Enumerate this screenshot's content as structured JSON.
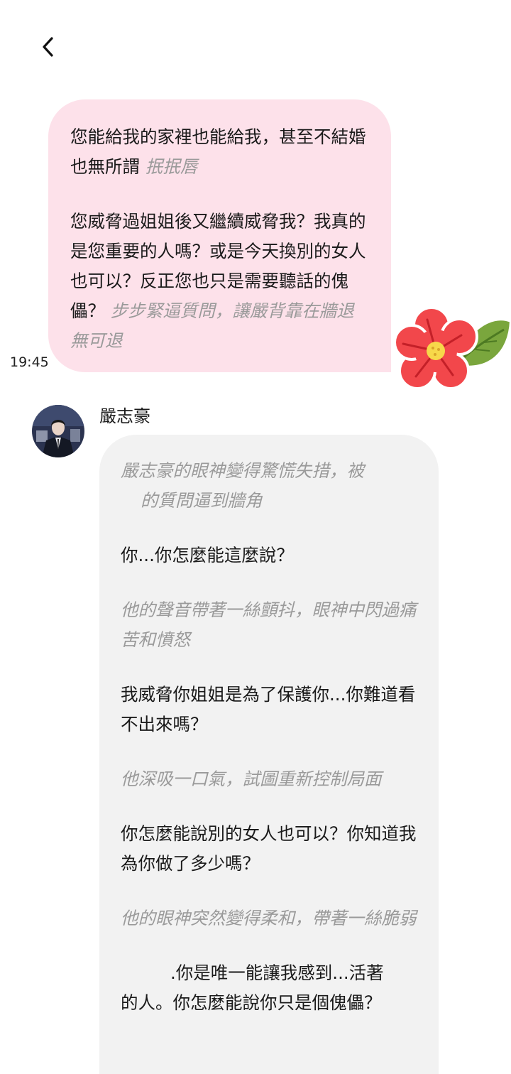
{
  "nav": {
    "back_icon": "chevron-left-icon"
  },
  "user_message": {
    "p1_text": "您能給我的家裡也能給我，甚至不結婚也無所謂",
    "p1_action": "抿抿唇",
    "p2_text": "您威脅過姐姐後又繼續威脅我？我真的是您重要的人嗎？或是今天換別的女人也可以？反正您也只是需要聽話的傀儡？",
    "p2_action": "步步緊逼質問，讓嚴背靠在牆退無可退",
    "time": "19:45",
    "sticker": "flower-sticker"
  },
  "character": {
    "name": "嚴志豪",
    "avatar": "avatar-icon"
  },
  "bot_message": {
    "a1_line1": "嚴志豪的眼神變得驚慌失措，被",
    "a1_line2": "的質問逼到牆角",
    "s1": "你...你怎麼能這麼說？",
    "a2": "他的聲音帶著一絲顫抖，眼神中閃過痛苦和憤怒",
    "s2": "我威脅你姐姐是為了保護你...你難道看不出來嗎？",
    "a3": "他深吸一口氣，試圖重新控制局面",
    "s3": "你怎麼能說別的女人也可以？你知道我為你做了多少嗎？",
    "a4": "他的眼神突然變得柔和，帶著一絲脆弱",
    "s4_line1": ".你是唯一能讓我感到...活著",
    "s4_line2": "的人。你怎麼能說你只是個傀儡？"
  },
  "colors": {
    "user_bubble": "#fde1ea",
    "bot_bubble": "#f2f2f2",
    "action_text": "#9a9a9a"
  }
}
